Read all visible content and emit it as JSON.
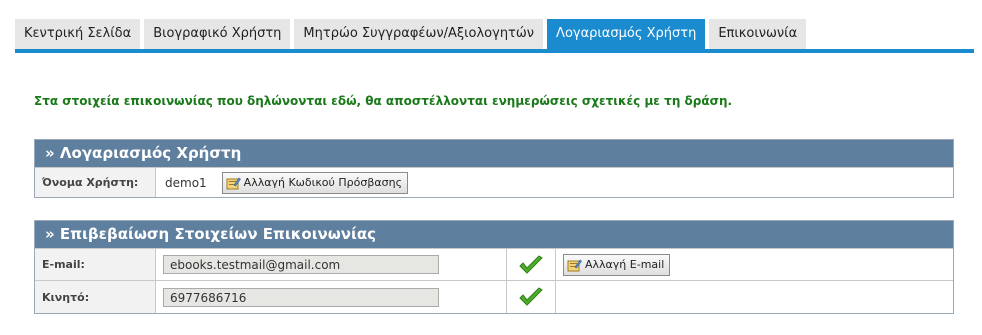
{
  "tabs": [
    {
      "label": "Κεντρική Σελίδα",
      "active": false
    },
    {
      "label": "Βιογραφικό Χρήστη",
      "active": false
    },
    {
      "label": "Μητρώο Συγγραφέων/Αξιολογητών",
      "active": false
    },
    {
      "label": "Λογαριασμός Χρήστη",
      "active": true
    },
    {
      "label": "Επικοινωνία",
      "active": false
    }
  ],
  "notice": "Στα στοιχεία επικοινωνίας που δηλώνονται εδώ, θα αποστέλλονται ενημερώσεις σχετικές με τη δράση.",
  "account": {
    "title": "» Λογαριασμός Χρήστη",
    "username_label": "Όνομα Χρήστη:",
    "username_value": "demo1",
    "change_password_label": "Αλλαγή Κωδικού Πρόσβασης"
  },
  "contact": {
    "title": "» Επιβεβαίωση Στοιχείων Επικοινωνίας",
    "email_label": "E-mail:",
    "email_value": "ebooks.testmail@gmail.com",
    "change_email_label": "Αλλαγή E-mail",
    "mobile_label": "Κινητό:",
    "mobile_value": "6977686716"
  },
  "colors": {
    "tab_active": "#1b8bd0",
    "panel_header": "#5f7f9f",
    "notice": "#1a7a1a",
    "check": "#4caf2a"
  },
  "icons": {
    "button_icon": "edit-icon",
    "verified": "checkmark-icon"
  }
}
